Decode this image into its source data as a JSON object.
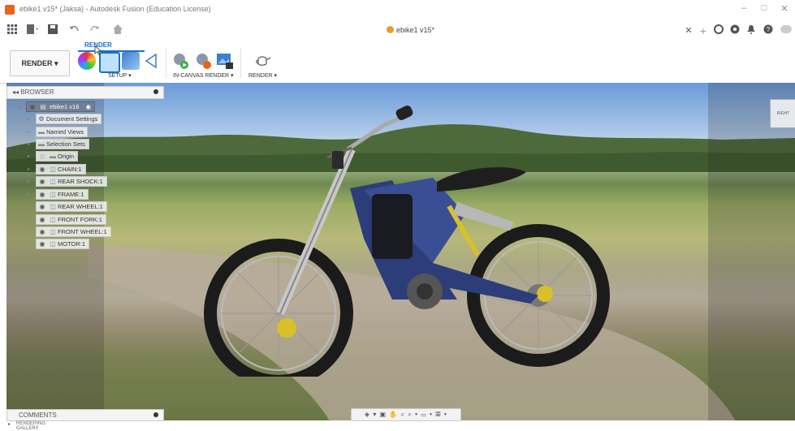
{
  "window": {
    "title": "ebike1 v15* (Jaksa) - Autodesk Fusion (Education License)",
    "controls": [
      "–",
      "□",
      "✕"
    ]
  },
  "quickbar": {
    "document_tab": "ebike1 v15*",
    "icons": [
      "grid-icon",
      "file-icon",
      "save-icon",
      "undo-icon",
      "redo-icon",
      "home-icon"
    ],
    "right_icons": [
      "close-tab-icon",
      "new-tab-icon",
      "extensions-icon",
      "job-status-icon",
      "notifications-icon",
      "help-icon",
      "account-icon"
    ]
  },
  "ribbon": {
    "active_tab": "RENDER",
    "workspace_button": "RENDER",
    "groups": {
      "setup": "SETUP ▾",
      "in_canvas": "IN-CANVAS RENDER ▾",
      "render": "RENDER ▾"
    }
  },
  "browser": {
    "header": "BROWSER",
    "root": "ebike1 v16",
    "items": [
      {
        "label": "Document Settings",
        "icon": "gear-icon"
      },
      {
        "label": "Named Views",
        "icon": "folder-icon"
      },
      {
        "label": "Selection Sets",
        "icon": "folder-icon"
      },
      {
        "label": "Origin",
        "icon": "folder-icon"
      },
      {
        "label": "CHAIN:1",
        "icon": "component-icon"
      },
      {
        "label": "REAR SHOCK:1",
        "icon": "component-icon"
      },
      {
        "label": "FRAME:1",
        "icon": "component-icon"
      },
      {
        "label": "REAR WHEEL:1",
        "icon": "component-icon"
      },
      {
        "label": "FRONT FORK:1",
        "icon": "component-icon"
      },
      {
        "label": "FRONT WHEEL:1",
        "icon": "component-icon"
      },
      {
        "label": "MOTOR:1",
        "icon": "component-icon"
      }
    ]
  },
  "viewcube": {
    "face": "RIGHT"
  },
  "comments": {
    "label": "COMMENTS"
  },
  "navbar": {
    "icons": "◈ ▾ ▣ ✋ ⌕ ⌕ ▾ ▭ ▾ ▦ ▾"
  },
  "gallery": {
    "label": "RENDERING GALLERY"
  }
}
